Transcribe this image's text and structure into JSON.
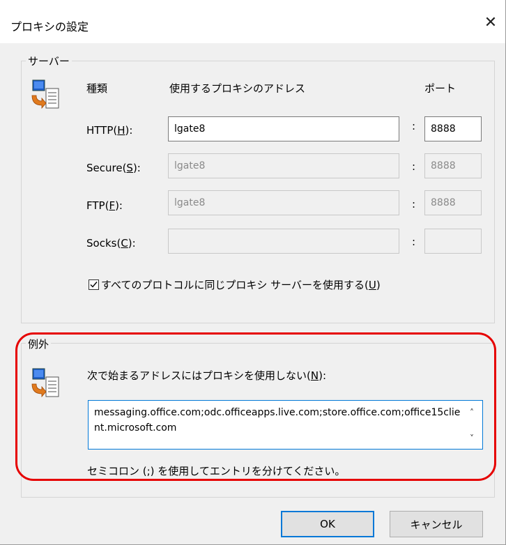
{
  "window": {
    "title": "プロキシの設定",
    "close_glyph": "✕"
  },
  "servers": {
    "group_label": "サーバー",
    "headers": {
      "type": "種類",
      "address": "使用するプロキシのアドレス",
      "port": "ポート"
    },
    "rows": [
      {
        "label": "HTTP(",
        "mnemonic": "H",
        "label_end": "):",
        "address": "lgate8",
        "port": "8888",
        "enabled": true
      },
      {
        "label": "Secure(",
        "mnemonic": "S",
        "label_end": "):",
        "address": "lgate8",
        "port": "8888",
        "enabled": false
      },
      {
        "label": "FTP(",
        "mnemonic": "F",
        "label_end": "):",
        "address": "lgate8",
        "port": "8888",
        "enabled": false
      },
      {
        "label": "Socks(",
        "mnemonic": "C",
        "label_end": "):",
        "address": "",
        "port": "",
        "enabled": false
      }
    ],
    "colon": ":",
    "same_proxy": {
      "label": "すべてのプロトコルに同じプロキシ サーバーを使用する(",
      "mnemonic": "U",
      "label_end": ")",
      "checked": true
    }
  },
  "exceptions": {
    "group_label": "例外",
    "prompt": "次で始まるアドレスにはプロキシを使用しない(",
    "prompt_mnemonic": "N",
    "prompt_end": "):",
    "value": "messaging.office.com;odc.officeapps.live.com;store.office.com;office15client.microsoft.com",
    "hint": "セミコロン (;) を使用してエントリを分けてください。"
  },
  "buttons": {
    "ok": "OK",
    "cancel": "キャンセル"
  },
  "colors": {
    "highlight": "#e60000",
    "focus": "#0078d7"
  }
}
